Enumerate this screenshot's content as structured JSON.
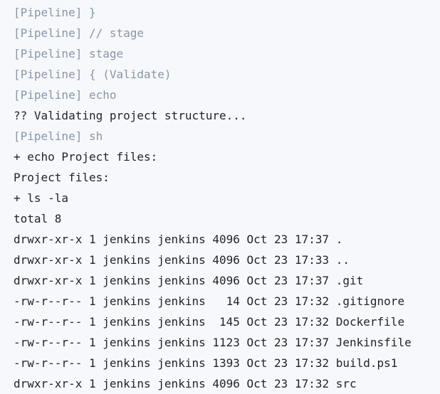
{
  "colors": {
    "background": "#f6f8fb",
    "pipeline_text": "#8b96a7",
    "output_text": "#1f2328"
  },
  "console": {
    "lines": [
      {
        "text": "[Pipeline] }",
        "kind": "pipeline"
      },
      {
        "text": "[Pipeline] // stage",
        "kind": "pipeline"
      },
      {
        "text": "[Pipeline] stage",
        "kind": "pipeline"
      },
      {
        "text": "[Pipeline] { (Validate)",
        "kind": "pipeline"
      },
      {
        "text": "[Pipeline] echo",
        "kind": "pipeline"
      },
      {
        "text": "?? Validating project structure...",
        "kind": "output"
      },
      {
        "text": "[Pipeline] sh",
        "kind": "pipeline"
      },
      {
        "text": "+ echo Project files:",
        "kind": "cmd"
      },
      {
        "text": "Project files:",
        "kind": "output"
      },
      {
        "text": "+ ls -la",
        "kind": "cmd"
      },
      {
        "text": "total 8",
        "kind": "output"
      },
      {
        "text": "drwxr-xr-x 1 jenkins jenkins 4096 Oct 23 17:37 .",
        "kind": "output"
      },
      {
        "text": "drwxr-xr-x 1 jenkins jenkins 4096 Oct 23 17:33 ..",
        "kind": "output"
      },
      {
        "text": "drwxr-xr-x 1 jenkins jenkins 4096 Oct 23 17:37 .git",
        "kind": "output"
      },
      {
        "text": "-rw-r--r-- 1 jenkins jenkins   14 Oct 23 17:32 .gitignore",
        "kind": "output"
      },
      {
        "text": "-rw-r--r-- 1 jenkins jenkins  145 Oct 23 17:32 Dockerfile",
        "kind": "output"
      },
      {
        "text": "-rw-r--r-- 1 jenkins jenkins 1123 Oct 23 17:37 Jenkinsfile",
        "kind": "output"
      },
      {
        "text": "-rw-r--r-- 1 jenkins jenkins 1393 Oct 23 17:32 build.ps1",
        "kind": "output"
      },
      {
        "text": "drwxr-xr-x 1 jenkins jenkins 4096 Oct 23 17:32 src",
        "kind": "output"
      }
    ]
  }
}
